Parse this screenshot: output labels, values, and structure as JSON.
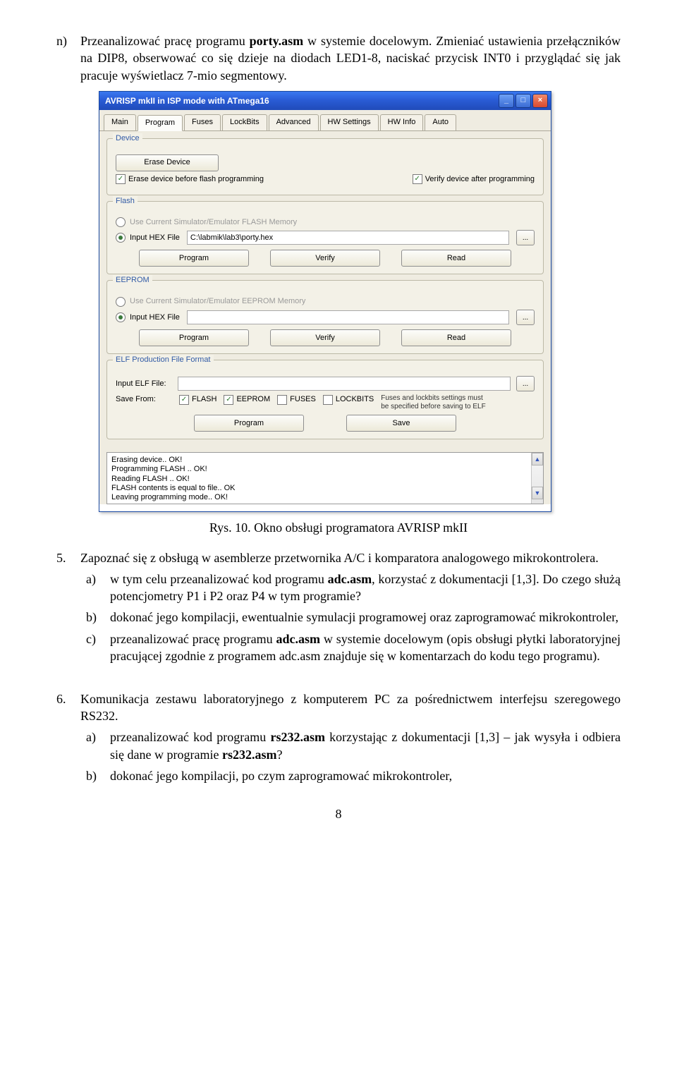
{
  "doc": {
    "item_n_marker": "n)",
    "item_n_text": "Przeanalizować pracę programu porty.asm w systemie docelowym. Zmieniać ustawienia przełączników na DIP8, obserwować co się dzieje na diodach LED1-8, naciskać przycisk INT0 i przyglądać się jak pracuje wyświetlacz 7-mio segmentowy.",
    "caption": "Rys. 10. Okno obsługi programatora AVRISP mkII",
    "item5_marker": "5.",
    "item5_text": "Zapoznać się z obsługą w asemblerze przetwornika A/C i komparatora analogowego mikrokontrolera.",
    "item5a_marker": "a)",
    "item5a_text": "w tym celu przeanalizować kod programu adc.asm, korzystać z dokumentacji [1,3]. Do czego służą potencjometry P1 i P2 oraz P4 w tym programie?",
    "item5b_marker": "b)",
    "item5b_text": "dokonać jego kompilacji, ewentualnie symulacji programowej oraz zaprogramować mikrokontroler,",
    "item5c_marker": "c)",
    "item5c_text": "przeanalizować pracę programu adc.asm w systemie docelowym (opis obsługi płytki laboratoryjnej pracującej zgodnie z programem adc.asm znajduje się w komentarzach do kodu tego programu).",
    "item6_marker": "6.",
    "item6_text": "Komunikacja zestawu laboratoryjnego z komputerem PC za pośrednictwem interfejsu szeregowego RS232.",
    "item6a_marker": "a)",
    "item6a_text": "przeanalizować kod programu rs232.asm korzystając z dokumentacji [1,3] – jak wysyła i odbiera się dane w programie rs232.asm?",
    "item6b_marker": "b)",
    "item6b_text": "dokonać jego kompilacji, po czym zaprogramować mikrokontroler,",
    "pagenum": "8"
  },
  "win": {
    "title": "AVRISP mkII in ISP mode with ATmega16",
    "tabs": [
      "Main",
      "Program",
      "Fuses",
      "LockBits",
      "Advanced",
      "HW Settings",
      "HW Info",
      "Auto"
    ],
    "activeTab": "Program",
    "device": {
      "title": "Device",
      "erase_btn": "Erase Device",
      "chk_erase": "Erase device before flash programming",
      "chk_verify": "Verify device after programming"
    },
    "flash": {
      "title": "Flash",
      "radio_sim": "Use Current Simulator/Emulator FLASH Memory",
      "radio_hex": "Input HEX File",
      "hex_path": "C:\\labmik\\lab3\\porty.hex",
      "btn_program": "Program",
      "btn_verify": "Verify",
      "btn_read": "Read"
    },
    "eeprom": {
      "title": "EEPROM",
      "radio_sim": "Use Current Simulator/Emulator EEPROM Memory",
      "radio_hex": "Input HEX File",
      "hex_path": "",
      "btn_program": "Program",
      "btn_verify": "Verify",
      "btn_read": "Read"
    },
    "elf": {
      "title": "ELF Production File Format",
      "input_label": "Input ELF File:",
      "input_value": "",
      "savefrom_label": "Save From:",
      "chk_flash": "FLASH",
      "chk_eeprom": "EEPROM",
      "chk_fuses": "FUSES",
      "chk_lockbits": "LOCKBITS",
      "hint": "Fuses and lockbits settings must be specified before saving to ELF",
      "btn_program": "Program",
      "btn_save": "Save"
    },
    "log": {
      "l1": "Erasing device..  OK!",
      "l2": "Programming FLASH ..      OK!",
      "l3": "Reading FLASH ..      OK!",
      "l4": "FLASH contents is equal to file.. OK",
      "l5": "Leaving programming mode.. OK!"
    },
    "browse": "..."
  }
}
